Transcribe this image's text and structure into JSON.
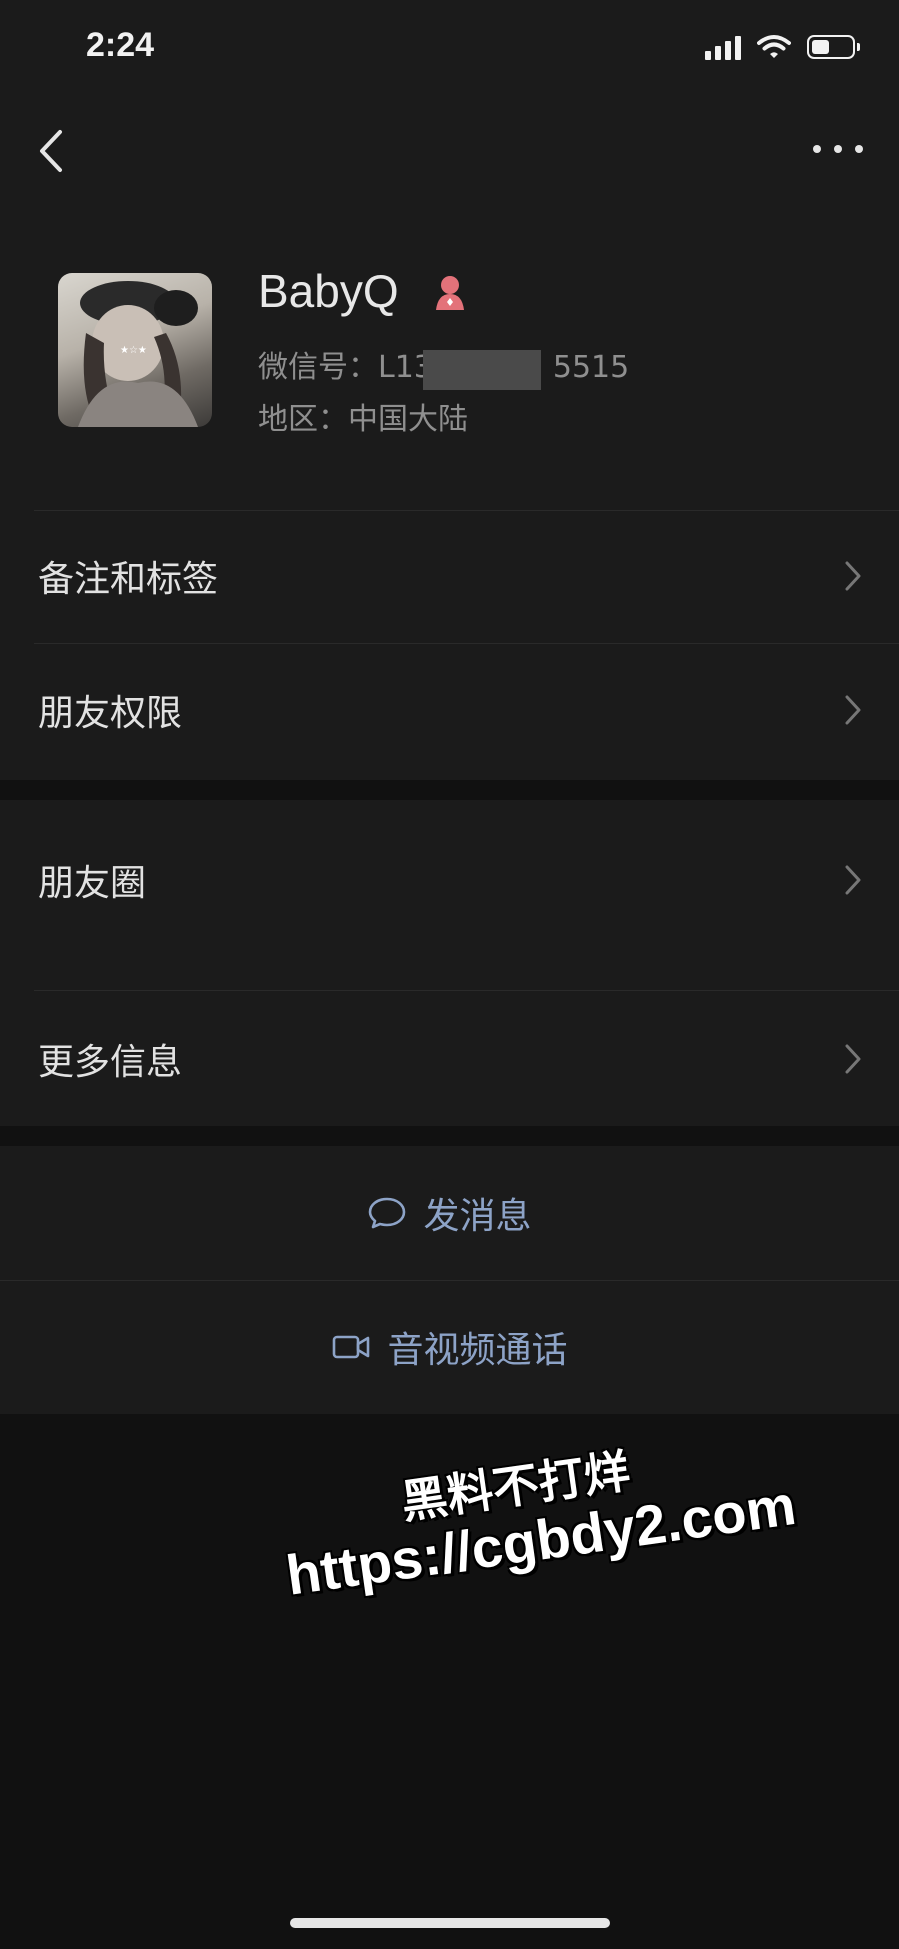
{
  "status_bar": {
    "time": "2:24",
    "battery_level": 0.45
  },
  "profile": {
    "name": "BabyQ",
    "wechat_id": "微信号：L13　　　　5515",
    "region": "地区：中国大陆"
  },
  "menu_group1": [
    {
      "label": "备注和标签"
    },
    {
      "label": "朋友权限"
    }
  ],
  "menu_group2": [
    {
      "label": "朋友圈"
    },
    {
      "label": "更多信息"
    }
  ],
  "actions": {
    "message_label": "发消息",
    "call_label": "音视频通话"
  },
  "watermark": {
    "line1": "黑料不打烊",
    "line2": "https://cgbdy2.com"
  },
  "colors": {
    "background": "#111111",
    "panel": "#1b1b1b",
    "link": "#8da3c7",
    "gender_female": "#e3727a"
  }
}
